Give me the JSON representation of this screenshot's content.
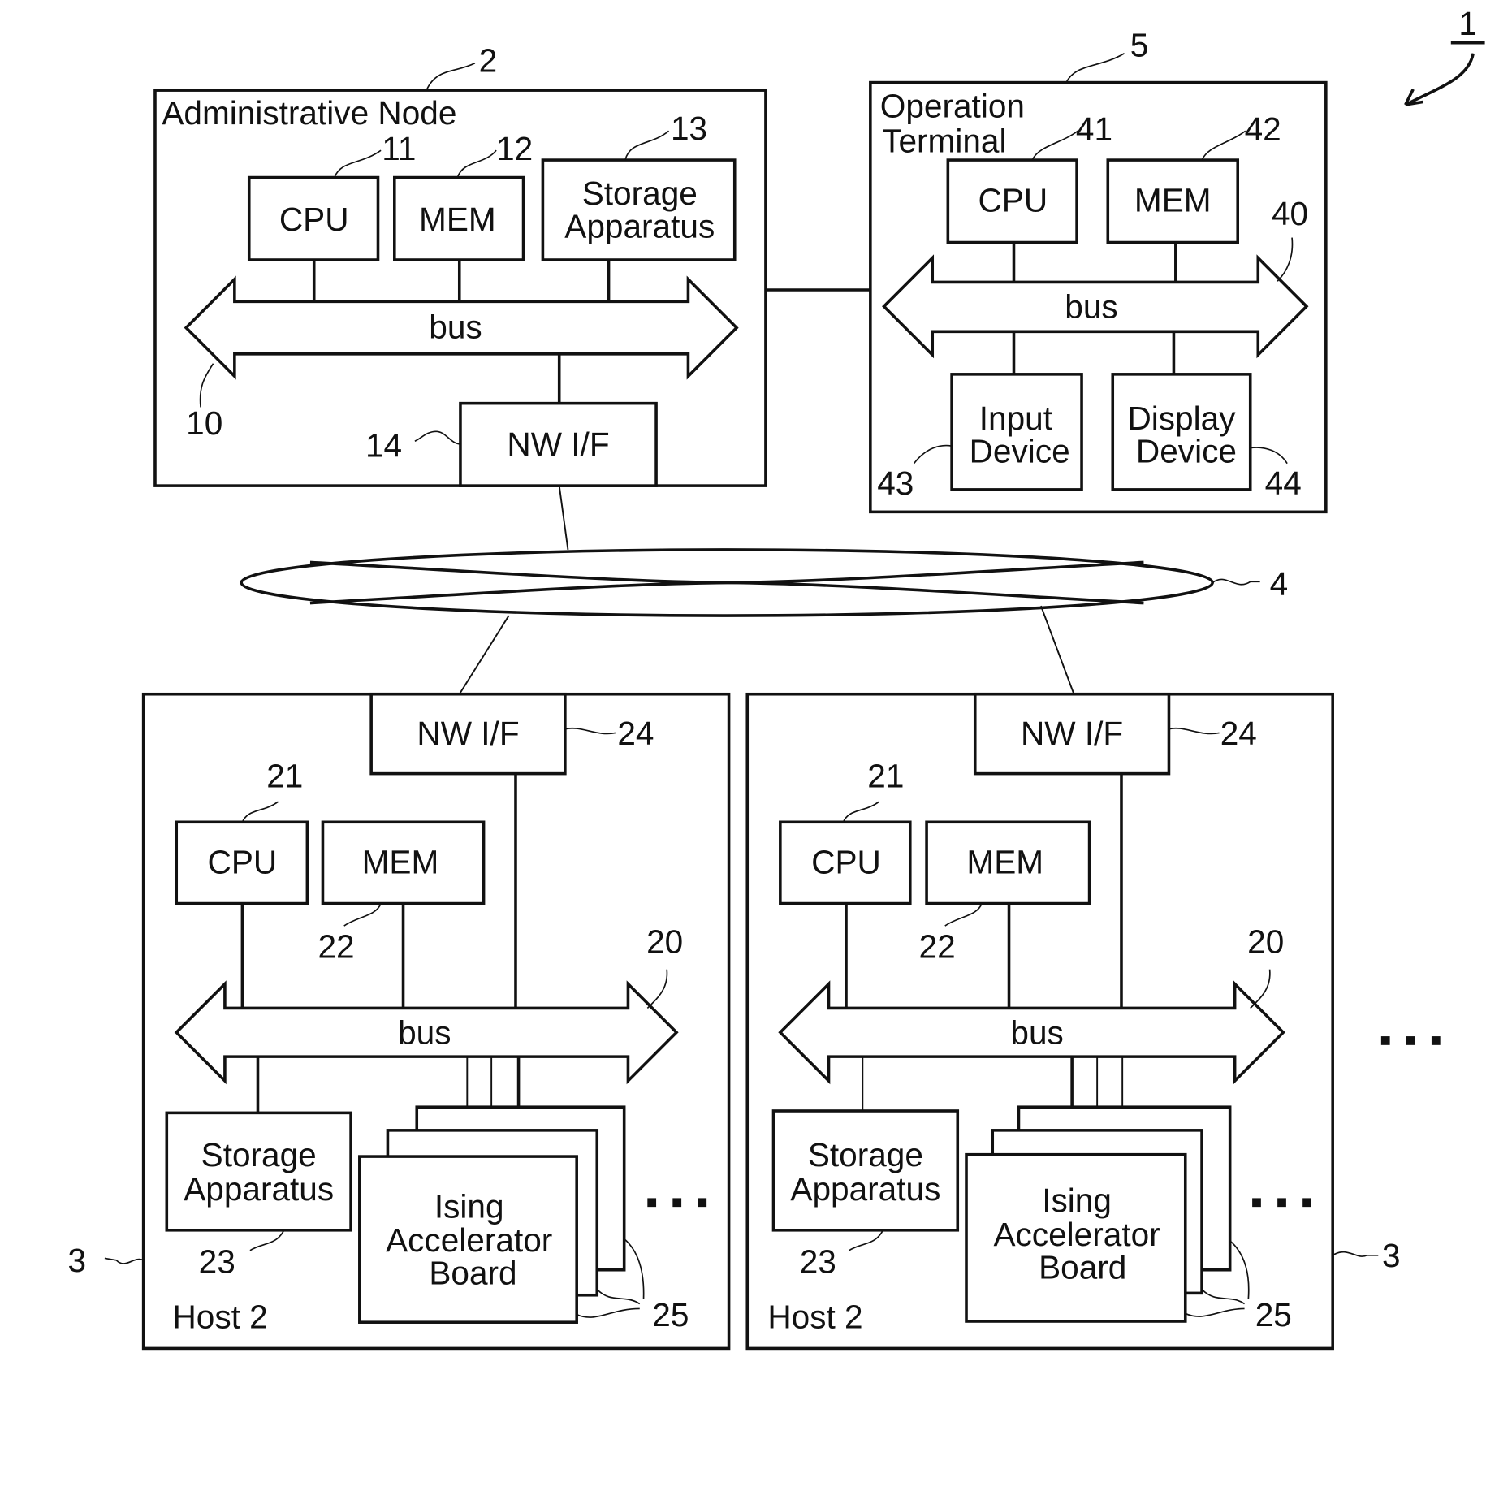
{
  "figure": {
    "system_ref": "1"
  },
  "admin_node": {
    "title": "Administrative Node",
    "ref": "2",
    "cpu": {
      "label": "CPU",
      "ref": "11"
    },
    "mem": {
      "label": "MEM",
      "ref": "12"
    },
    "storage": {
      "line1": "Storage",
      "line2": "Apparatus",
      "ref": "13"
    },
    "bus": {
      "label": "bus",
      "ref": "10"
    },
    "nwif": {
      "label": "NW I/F",
      "ref": "14"
    }
  },
  "operation_terminal": {
    "title_line1": "Operation",
    "title_line2": "Terminal",
    "ref": "5",
    "cpu": {
      "label": "CPU",
      "ref": "41"
    },
    "mem": {
      "label": "MEM",
      "ref": "42"
    },
    "bus": {
      "label": "bus",
      "ref": "40"
    },
    "input": {
      "line1": "Input",
      "line2": "Device",
      "ref": "43"
    },
    "display": {
      "line1": "Display",
      "line2": "Device",
      "ref": "44"
    }
  },
  "network": {
    "ref": "4"
  },
  "hosts": [
    {
      "title": "Host 2",
      "ref": "3",
      "nwif": {
        "label": "NW I/F",
        "ref": "24"
      },
      "cpu": {
        "label": "CPU",
        "ref": "21"
      },
      "mem": {
        "label": "MEM",
        "ref": "22"
      },
      "bus": {
        "label": "bus",
        "ref": "20"
      },
      "storage": {
        "line1": "Storage",
        "line2": "Apparatus",
        "ref": "23"
      },
      "board": {
        "line1": "Ising",
        "line2": "Accelerator",
        "line3": "Board",
        "ref": "25"
      },
      "more": "..."
    },
    {
      "title": "Host 2",
      "ref": "3",
      "nwif": {
        "label": "NW I/F",
        "ref": "24"
      },
      "cpu": {
        "label": "CPU",
        "ref": "21"
      },
      "mem": {
        "label": "MEM",
        "ref": "22"
      },
      "bus": {
        "label": "bus",
        "ref": "20"
      },
      "storage": {
        "line1": "Storage",
        "line2": "Apparatus",
        "ref": "23"
      },
      "board": {
        "line1": "Ising",
        "line2": "Accelerator",
        "line3": "Board",
        "ref": "25"
      },
      "more": "..."
    }
  ],
  "more_hosts": "..."
}
